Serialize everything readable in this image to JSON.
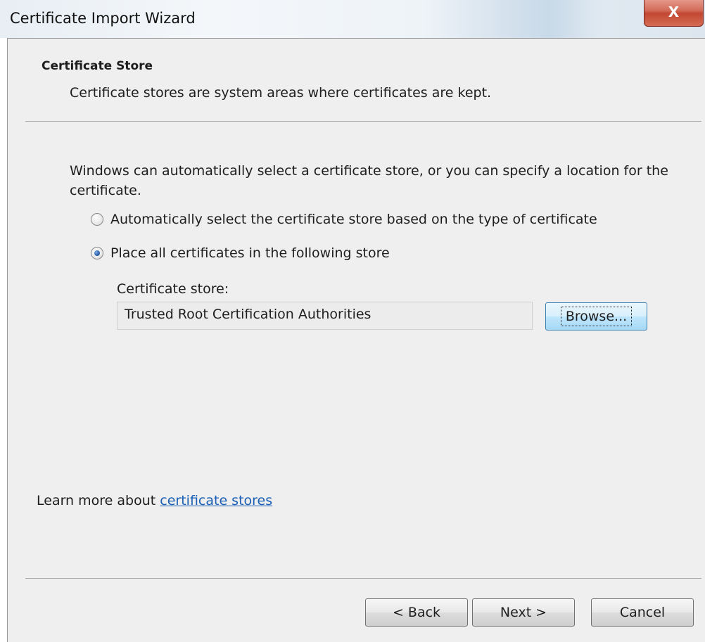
{
  "window": {
    "title": "Certificate Import Wizard",
    "close_glyph": "X"
  },
  "header": {
    "title": "Certificate Store",
    "description": "Certificate stores are system areas where certificates are kept."
  },
  "body": {
    "intro": "Windows can automatically select a certificate store, or you can specify a location for the certificate.",
    "options": [
      {
        "label": "Automatically select the certificate store based on the type of certificate",
        "checked": false
      },
      {
        "label": "Place all certificates in the following store",
        "checked": true
      }
    ],
    "store_label": "Certificate store:",
    "store_value": "Trusted Root Certification Authorities",
    "browse_label": "Browse..."
  },
  "learn_more": {
    "prefix": "Learn more about ",
    "link_text": "certificate stores"
  },
  "footer": {
    "back_label": "< Back",
    "next_label": "Next >",
    "cancel_label": "Cancel"
  }
}
